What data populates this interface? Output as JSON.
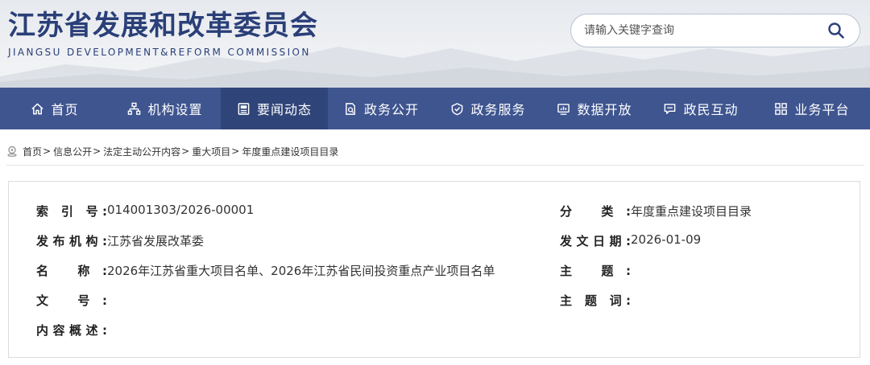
{
  "header": {
    "title": "江苏省发展和改革委员会",
    "subtitle": "JIANGSU DEVELOPMENT&REFORM COMMISSION",
    "search": {
      "placeholder": "请输入关键字查询"
    }
  },
  "nav": {
    "active_index": 2,
    "items": [
      {
        "label": "首页",
        "icon": "home-icon"
      },
      {
        "label": "机构设置",
        "icon": "org-chart-icon"
      },
      {
        "label": "要闻动态",
        "icon": "news-icon"
      },
      {
        "label": "政务公开",
        "icon": "document-search-icon"
      },
      {
        "label": "政务服务",
        "icon": "service-icon"
      },
      {
        "label": "数据开放",
        "icon": "data-chart-icon"
      },
      {
        "label": "政民互动",
        "icon": "chat-icon"
      },
      {
        "label": "业务平台",
        "icon": "grid-icon"
      }
    ]
  },
  "breadcrumb": {
    "items": [
      "首页",
      "信息公开",
      "法定主动公开内容",
      "重大项目",
      "年度重点建设项目目录"
    ],
    "separator": ">"
  },
  "info": {
    "index_label": "索 引 号:",
    "index_value": "014001303/2026-00001",
    "category_label": "分 类:",
    "category_value": "年度重点建设项目目录",
    "publisher_label": "发布机构:",
    "publisher_value": "江苏省发展改革委",
    "date_label": "发文日期:",
    "date_value": "2026-01-09",
    "name_label": "名 称:",
    "name_value": "2026年江苏省重大项目名单、2026年江苏省民间投资重点产业项目名单",
    "subject_label": "主 题:",
    "subject_value": "",
    "docno_label": "文 号:",
    "docno_value": "",
    "keywords_label": "主 题 词:",
    "keywords_value": "",
    "summary_label": "内容概述:",
    "summary_value": ""
  },
  "colors": {
    "brand": "#2a3f78",
    "nav_bg": "#3f5590",
    "nav_active": "#2f4478"
  }
}
